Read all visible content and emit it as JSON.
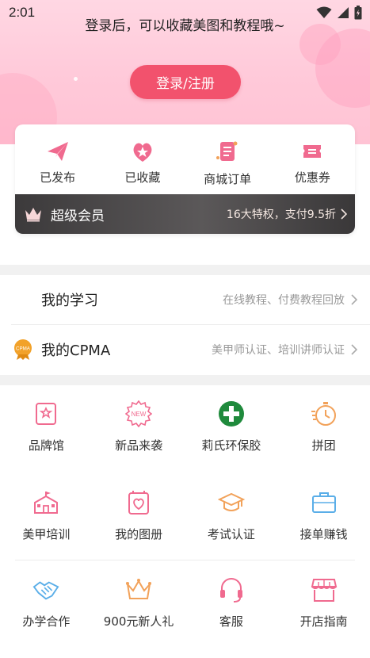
{
  "status_bar": {
    "time": "2:01"
  },
  "header": {
    "hint": "登录后，可以收藏美图和教程哦~",
    "login_button": "登录/注册"
  },
  "quick_actions": [
    {
      "label": "已发布",
      "icon": "paper-plane-icon"
    },
    {
      "label": "已收藏",
      "icon": "star-heart-icon"
    },
    {
      "label": "商城订单",
      "icon": "order-list-icon"
    },
    {
      "label": "优惠券",
      "icon": "coupon-icon"
    }
  ],
  "vip": {
    "title": "超级会员",
    "description": "16大特权，支付9.5折",
    "icon": "crown-icon"
  },
  "menu_rows": [
    {
      "title": "我的学习",
      "description": "在线教程、付费教程回放"
    },
    {
      "title": "我的CPMA",
      "description": "美甲师认证、培训讲师认证",
      "badge": "CPMA"
    }
  ],
  "grid": [
    [
      {
        "label": "品牌馆",
        "icon": "brand-hall-icon"
      },
      {
        "label": "新品来袭",
        "icon": "new-badge-icon"
      },
      {
        "label": "莉氏环保胶",
        "icon": "green-cross-icon"
      },
      {
        "label": "拼团",
        "icon": "stopwatch-icon"
      }
    ],
    [
      {
        "label": "美甲培训",
        "icon": "school-icon"
      },
      {
        "label": "我的图册",
        "icon": "album-icon"
      },
      {
        "label": "考试认证",
        "icon": "graduation-cap-icon"
      },
      {
        "label": "接单赚钱",
        "icon": "briefcase-icon"
      }
    ],
    [
      {
        "label": "办学合作",
        "icon": "handshake-icon"
      },
      {
        "label": "900元新人礼",
        "icon": "crown-outline-icon"
      },
      {
        "label": "客服",
        "icon": "headset-icon"
      },
      {
        "label": "开店指南",
        "icon": "shop-icon"
      }
    ]
  ],
  "colors": {
    "accent": "#f2526d",
    "pink_icon": "#f06a8f",
    "orange_icon": "#f2a25a",
    "blue_icon": "#5aaee8",
    "green_icon": "#1f8a3c",
    "vip_bg": "#4a4748"
  }
}
